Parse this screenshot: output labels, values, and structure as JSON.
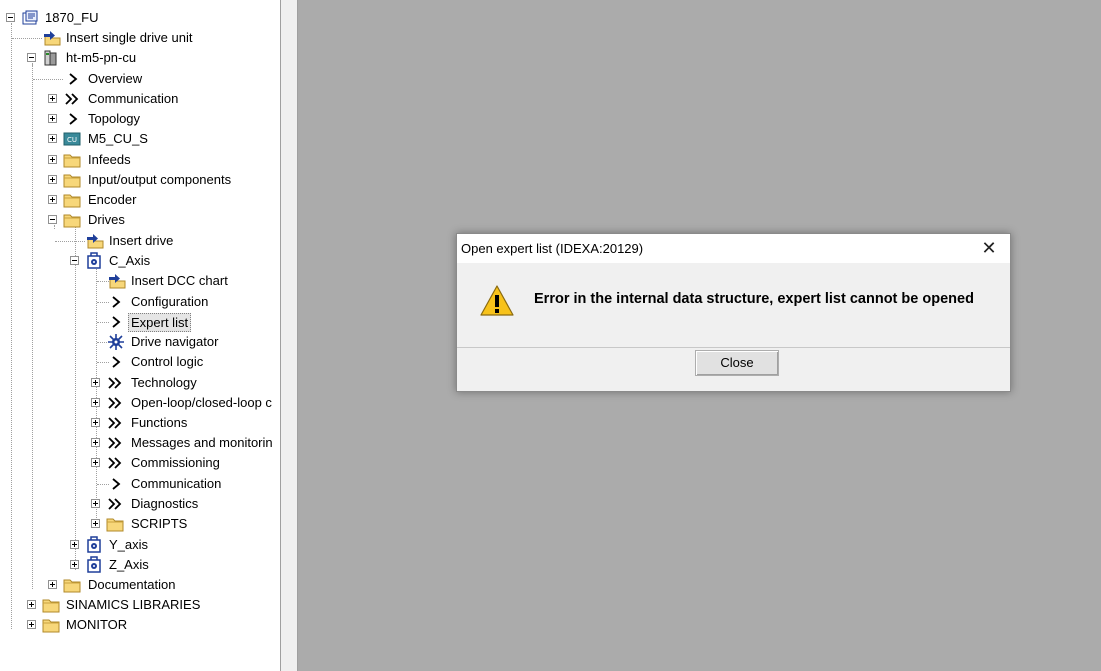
{
  "tree": {
    "root": "1870_FU",
    "insert_single_drive_unit": "Insert single drive unit",
    "device": "ht-m5-pn-cu",
    "overview": "Overview",
    "communication": "Communication",
    "topology": "Topology",
    "cu": "M5_CU_S",
    "infeeds": "Infeeds",
    "io_components": "Input/output components",
    "encoder": "Encoder",
    "drives": "Drives",
    "insert_drive": "Insert drive",
    "c_axis": "C_Axis",
    "insert_dcc_chart": "Insert DCC chart",
    "configuration": "Configuration",
    "expert_list": "Expert list",
    "drive_navigator": "Drive navigator",
    "control_logic": "Control logic",
    "technology": "Technology",
    "open_closed_loop": "Open-loop/closed-loop c",
    "functions": "Functions",
    "messages_monitoring": "Messages and monitorin",
    "commissioning": "Commissioning",
    "c_communication": "Communication",
    "diagnostics": "Diagnostics",
    "scripts": "SCRIPTS",
    "y_axis": "Y_axis",
    "z_axis": "Z_Axis",
    "documentation": "Documentation",
    "sinamics_libraries": "SINAMICS LIBRARIES",
    "monitor": "MONITOR"
  },
  "dialog": {
    "title": "Open expert list (IDEXA:20129)",
    "message": "Error in the internal data structure, expert list cannot be opened",
    "close_label": "Close",
    "close_glyph": "✕"
  },
  "icons": {
    "expand": "plus-box",
    "collapse": "minus-box",
    "folder": "folder",
    "arrow_single": "chevron-right",
    "arrow_double": "double-chevron-right",
    "warning": "warning-triangle"
  },
  "colors": {
    "workspace_bg": "#ababab",
    "folder_fill": "#f7d77a",
    "drive_blue": "#1f3f9a",
    "warning_yellow": "#f7c21b"
  }
}
